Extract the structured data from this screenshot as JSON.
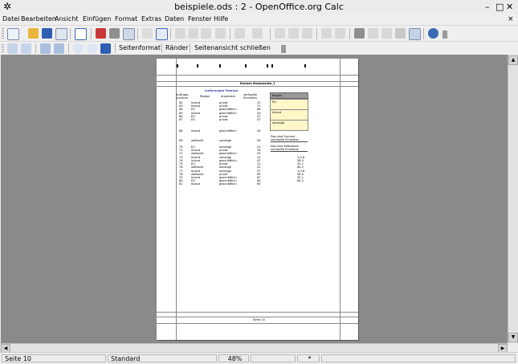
{
  "window": {
    "title": "beispiele.ods : 2 - OpenOffice.org Calc",
    "app_icon": "✲",
    "minimize": "–",
    "maximize": "□",
    "close": "✕",
    "doc_close": "×"
  },
  "menu": [
    "Datei",
    "Bearbeiten",
    "Ansicht",
    "Einfügen",
    "Format",
    "Extras",
    "Daten",
    "Fenster",
    "Hilfe"
  ],
  "preview_toolbar": {
    "page_format": "Seitenformat",
    "margins": "Ränder",
    "close_preview": "Seitenansicht schließen"
  },
  "page": {
    "sheet_name": "Kalmes Dokumente_1",
    "footer": "Seite 10",
    "table_title": "Lieferungen Februar",
    "col_headers": [
      "Auftrags-nummer",
      "Region",
      "Anwender",
      "verkaufte Einheiten"
    ],
    "rows": [
      [
        "62",
        "Inland",
        "privat",
        "21"
      ],
      [
        "63",
        "Inland",
        "privat",
        "17"
      ],
      [
        "64",
        "EU",
        "geschäftlich",
        "68"
      ],
      [
        "65",
        "Inland",
        "geschäftlich",
        "33"
      ],
      [
        "66",
        "EU",
        "privat",
        "47"
      ],
      [
        "67",
        "EU",
        "privat",
        "37"
      ],
      [
        "68",
        "Inland",
        "geschäftlich",
        "44"
      ],
      [
        "69",
        "weltweit",
        "sonstige",
        "59"
      ],
      [
        "70",
        "EU",
        "sonstige",
        "21"
      ],
      [
        "71",
        "Inland",
        "privat",
        "33"
      ],
      [
        "72",
        "weltweit",
        "geschäftlich",
        "29"
      ],
      [
        "73",
        "Inland",
        "sonstige",
        "22"
      ],
      [
        "74",
        "Inland",
        "geschäftlich",
        "47"
      ],
      [
        "75",
        "EU",
        "privat",
        "21"
      ],
      [
        "76",
        "weltweit",
        "sonstige",
        "41"
      ],
      [
        "77",
        "Inland",
        "sonstige",
        "57"
      ],
      [
        "78",
        "weltweit",
        "privat",
        "95"
      ],
      [
        "79",
        "Inland",
        "geschäftlich",
        "67"
      ],
      [
        "80",
        "EU",
        "geschäftlich",
        "44"
      ],
      [
        "81",
        "Inland",
        "geschäftlich",
        "65"
      ]
    ],
    "side_header": "Region",
    "side_values": [
      "EU",
      "Inland",
      "sonstige"
    ],
    "side_note1": "Das sind Summe - verkaufte Einheiten",
    "side_note2": "Das sind Mittelwert - verkaufte Einheiten",
    "right_values": [
      "1,0.6",
      "56.5",
      "32.1",
      "64.2",
      "1,0.6",
      "56.5",
      "32.1",
      "64.2"
    ]
  },
  "status": {
    "page": "Seite 10",
    "style": "Standard",
    "zoom": "48%",
    "modified": "*"
  }
}
